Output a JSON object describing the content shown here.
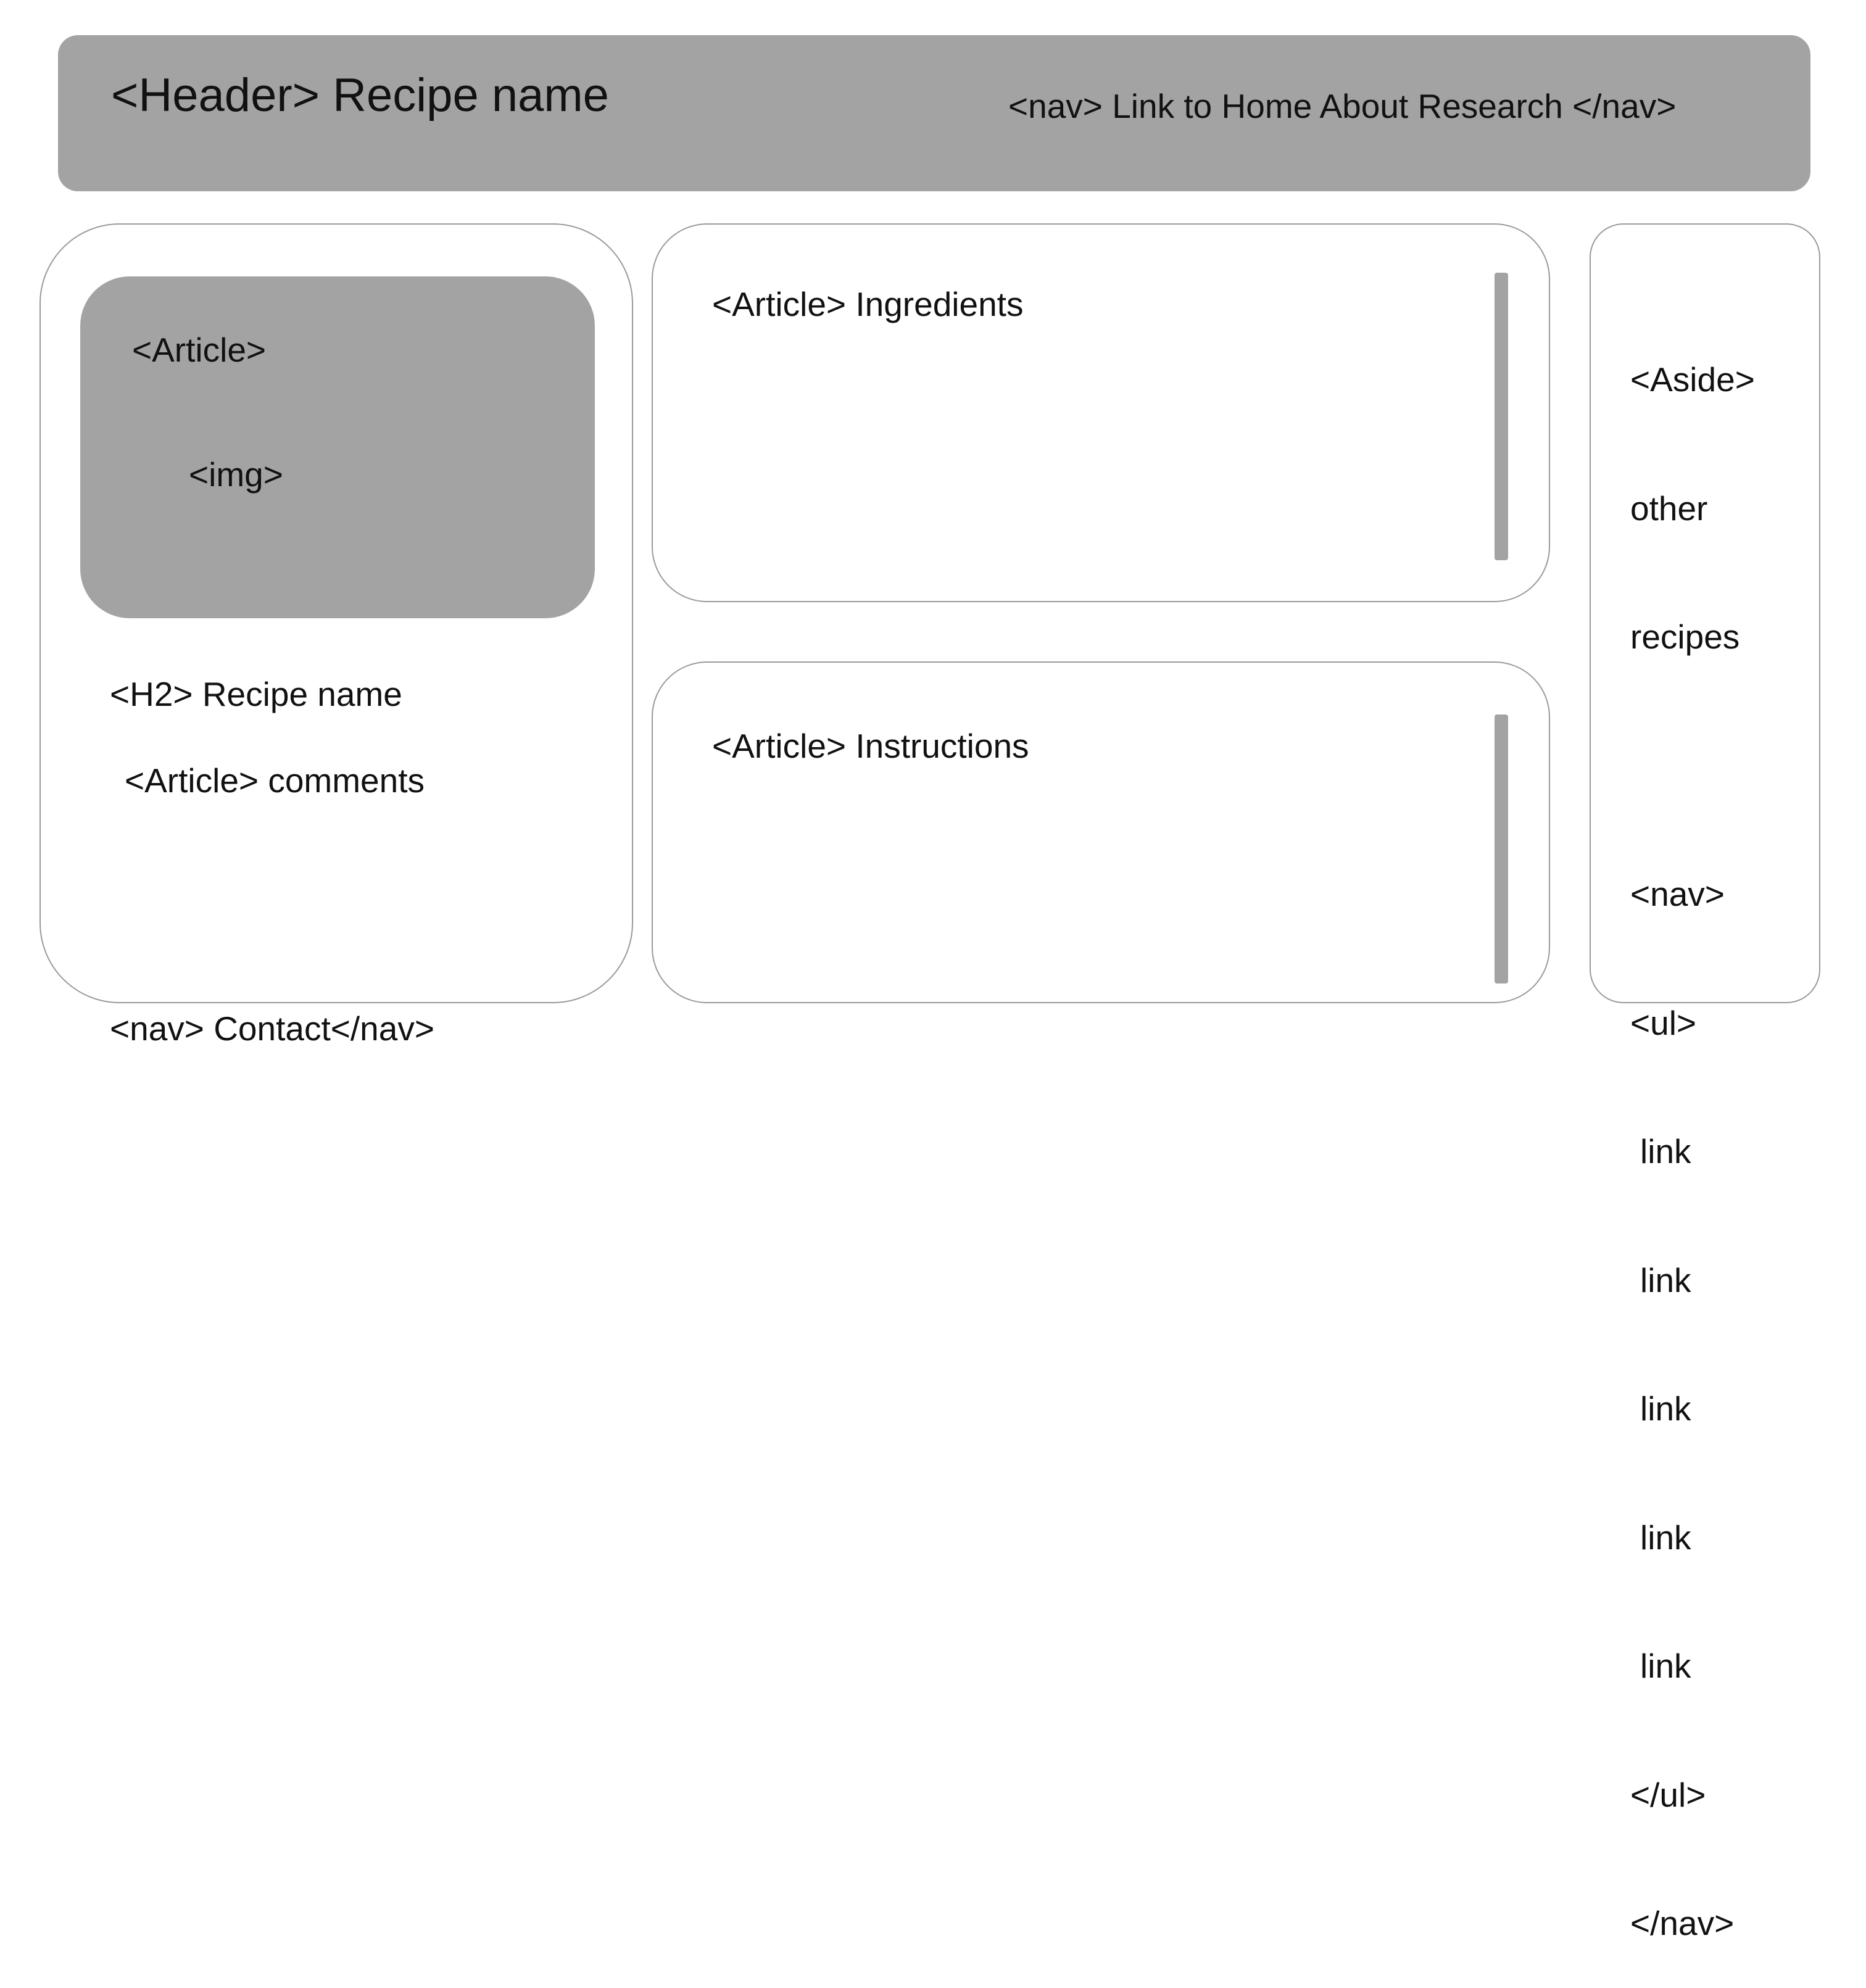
{
  "header": {
    "title": "<Header> Recipe name",
    "nav": "<nav> Link to Home About Research </nav>"
  },
  "left_panel": {
    "article_label": "<Article>",
    "img_label": "<img>",
    "h2_label": "<H2> Recipe name",
    "comments_label": "<Article> comments"
  },
  "ingredients": {
    "label": "<Article> Ingredients"
  },
  "instructions": {
    "label": "<Article> Instructions"
  },
  "aside": {
    "line1": "<Aside>",
    "line2": "other",
    "line3": "recipes",
    "nav_open": "<nav>",
    "ul_open": "<ul>",
    "links": [
      "link",
      "link",
      "link",
      "link",
      "link"
    ],
    "ul_close": "</ul>",
    "nav_close": "</nav>"
  },
  "footer": {
    "nav": "<nav> Contact</nav>"
  },
  "colors": {
    "block_fill": "#a3a3a3",
    "outline": "#9a9a9a",
    "text": "#111111"
  }
}
